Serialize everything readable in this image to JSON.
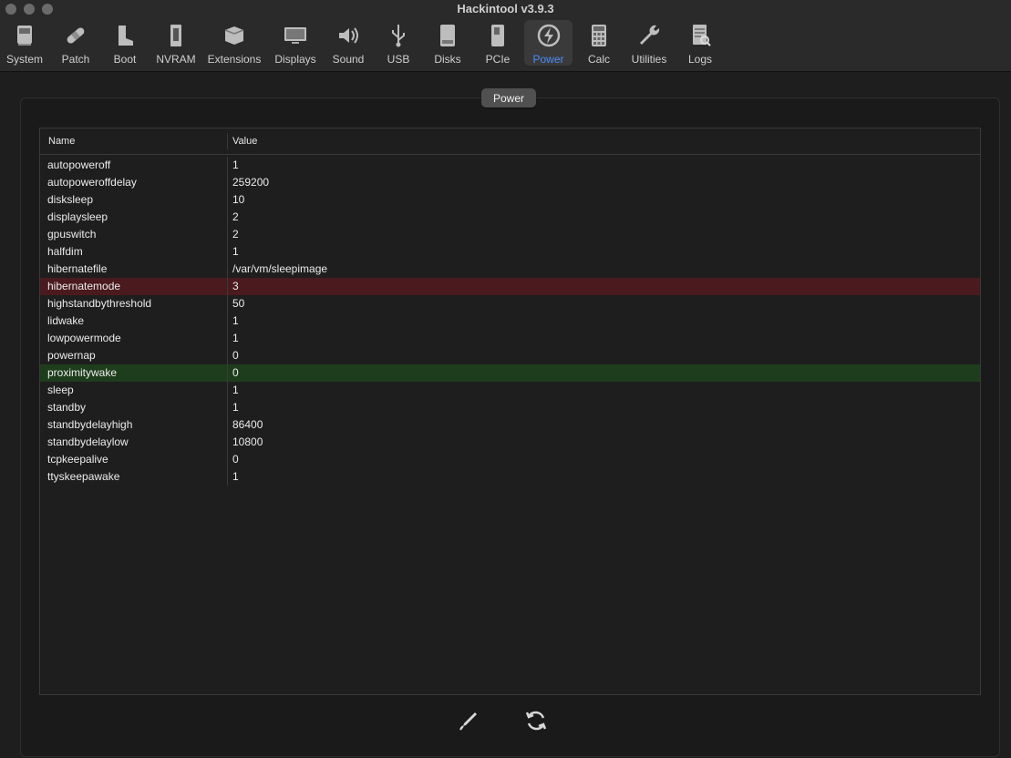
{
  "window": {
    "title": "Hackintool v3.9.3"
  },
  "toolbar": [
    {
      "label": "System",
      "icon": "system-icon"
    },
    {
      "label": "Patch",
      "icon": "patch-icon"
    },
    {
      "label": "Boot",
      "icon": "boot-icon"
    },
    {
      "label": "NVRAM",
      "icon": "nvram-icon"
    },
    {
      "label": "Extensions",
      "icon": "extensions-icon"
    },
    {
      "label": "Displays",
      "icon": "displays-icon"
    },
    {
      "label": "Sound",
      "icon": "sound-icon"
    },
    {
      "label": "USB",
      "icon": "usb-icon"
    },
    {
      "label": "Disks",
      "icon": "disks-icon"
    },
    {
      "label": "PCIe",
      "icon": "pcie-icon"
    },
    {
      "label": "Power",
      "icon": "power-icon",
      "active": true
    },
    {
      "label": "Calc",
      "icon": "calc-icon"
    },
    {
      "label": "Utilities",
      "icon": "utilities-icon"
    },
    {
      "label": "Logs",
      "icon": "logs-icon"
    }
  ],
  "panel": {
    "tab_label": "Power"
  },
  "table": {
    "headers": {
      "name": "Name",
      "value": "Value"
    },
    "rows": [
      {
        "name": "autopoweroff",
        "value": "1"
      },
      {
        "name": "autopoweroffdelay",
        "value": "259200"
      },
      {
        "name": "disksleep",
        "value": "10"
      },
      {
        "name": "displaysleep",
        "value": "2"
      },
      {
        "name": "gpuswitch",
        "value": "2"
      },
      {
        "name": "halfdim",
        "value": "1"
      },
      {
        "name": "hibernatefile",
        "value": "/var/vm/sleepimage"
      },
      {
        "name": "hibernatemode",
        "value": "3",
        "highlight": "red"
      },
      {
        "name": "highstandbythreshold",
        "value": "50"
      },
      {
        "name": "lidwake",
        "value": "1"
      },
      {
        "name": "lowpowermode",
        "value": "1"
      },
      {
        "name": "powernap",
        "value": "0"
      },
      {
        "name": "proximitywake",
        "value": "0",
        "highlight": "green"
      },
      {
        "name": "sleep",
        "value": "1"
      },
      {
        "name": "standby",
        "value": "1"
      },
      {
        "name": "standbydelayhigh",
        "value": "86400"
      },
      {
        "name": "standbydelaylow",
        "value": "10800"
      },
      {
        "name": "tcpkeepalive",
        "value": "0"
      },
      {
        "name": "ttyskeepawake",
        "value": "1"
      }
    ]
  },
  "colors": {
    "accent": "#4a8cf7",
    "highlight_red": "#4a1a1e",
    "highlight_green": "#1e3d1c"
  },
  "footer": {
    "edit_icon": "pencil-icon",
    "refresh_icon": "refresh-icon"
  }
}
